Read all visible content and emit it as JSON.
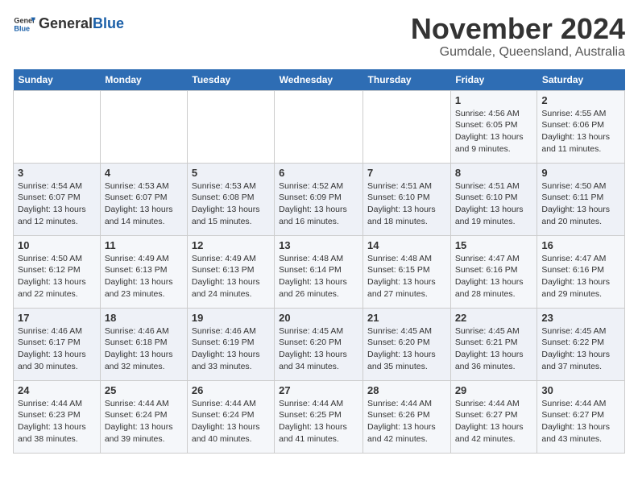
{
  "header": {
    "logo_general": "General",
    "logo_blue": "Blue",
    "month_title": "November 2024",
    "subtitle": "Gumdale, Queensland, Australia"
  },
  "weekdays": [
    "Sunday",
    "Monday",
    "Tuesday",
    "Wednesday",
    "Thursday",
    "Friday",
    "Saturday"
  ],
  "weeks": [
    [
      {
        "day": "",
        "info": ""
      },
      {
        "day": "",
        "info": ""
      },
      {
        "day": "",
        "info": ""
      },
      {
        "day": "",
        "info": ""
      },
      {
        "day": "",
        "info": ""
      },
      {
        "day": "1",
        "info": "Sunrise: 4:56 AM\nSunset: 6:05 PM\nDaylight: 13 hours and 9 minutes."
      },
      {
        "day": "2",
        "info": "Sunrise: 4:55 AM\nSunset: 6:06 PM\nDaylight: 13 hours and 11 minutes."
      }
    ],
    [
      {
        "day": "3",
        "info": "Sunrise: 4:54 AM\nSunset: 6:07 PM\nDaylight: 13 hours and 12 minutes."
      },
      {
        "day": "4",
        "info": "Sunrise: 4:53 AM\nSunset: 6:07 PM\nDaylight: 13 hours and 14 minutes."
      },
      {
        "day": "5",
        "info": "Sunrise: 4:53 AM\nSunset: 6:08 PM\nDaylight: 13 hours and 15 minutes."
      },
      {
        "day": "6",
        "info": "Sunrise: 4:52 AM\nSunset: 6:09 PM\nDaylight: 13 hours and 16 minutes."
      },
      {
        "day": "7",
        "info": "Sunrise: 4:51 AM\nSunset: 6:10 PM\nDaylight: 13 hours and 18 minutes."
      },
      {
        "day": "8",
        "info": "Sunrise: 4:51 AM\nSunset: 6:10 PM\nDaylight: 13 hours and 19 minutes."
      },
      {
        "day": "9",
        "info": "Sunrise: 4:50 AM\nSunset: 6:11 PM\nDaylight: 13 hours and 20 minutes."
      }
    ],
    [
      {
        "day": "10",
        "info": "Sunrise: 4:50 AM\nSunset: 6:12 PM\nDaylight: 13 hours and 22 minutes."
      },
      {
        "day": "11",
        "info": "Sunrise: 4:49 AM\nSunset: 6:13 PM\nDaylight: 13 hours and 23 minutes."
      },
      {
        "day": "12",
        "info": "Sunrise: 4:49 AM\nSunset: 6:13 PM\nDaylight: 13 hours and 24 minutes."
      },
      {
        "day": "13",
        "info": "Sunrise: 4:48 AM\nSunset: 6:14 PM\nDaylight: 13 hours and 26 minutes."
      },
      {
        "day": "14",
        "info": "Sunrise: 4:48 AM\nSunset: 6:15 PM\nDaylight: 13 hours and 27 minutes."
      },
      {
        "day": "15",
        "info": "Sunrise: 4:47 AM\nSunset: 6:16 PM\nDaylight: 13 hours and 28 minutes."
      },
      {
        "day": "16",
        "info": "Sunrise: 4:47 AM\nSunset: 6:16 PM\nDaylight: 13 hours and 29 minutes."
      }
    ],
    [
      {
        "day": "17",
        "info": "Sunrise: 4:46 AM\nSunset: 6:17 PM\nDaylight: 13 hours and 30 minutes."
      },
      {
        "day": "18",
        "info": "Sunrise: 4:46 AM\nSunset: 6:18 PM\nDaylight: 13 hours and 32 minutes."
      },
      {
        "day": "19",
        "info": "Sunrise: 4:46 AM\nSunset: 6:19 PM\nDaylight: 13 hours and 33 minutes."
      },
      {
        "day": "20",
        "info": "Sunrise: 4:45 AM\nSunset: 6:20 PM\nDaylight: 13 hours and 34 minutes."
      },
      {
        "day": "21",
        "info": "Sunrise: 4:45 AM\nSunset: 6:20 PM\nDaylight: 13 hours and 35 minutes."
      },
      {
        "day": "22",
        "info": "Sunrise: 4:45 AM\nSunset: 6:21 PM\nDaylight: 13 hours and 36 minutes."
      },
      {
        "day": "23",
        "info": "Sunrise: 4:45 AM\nSunset: 6:22 PM\nDaylight: 13 hours and 37 minutes."
      }
    ],
    [
      {
        "day": "24",
        "info": "Sunrise: 4:44 AM\nSunset: 6:23 PM\nDaylight: 13 hours and 38 minutes."
      },
      {
        "day": "25",
        "info": "Sunrise: 4:44 AM\nSunset: 6:24 PM\nDaylight: 13 hours and 39 minutes."
      },
      {
        "day": "26",
        "info": "Sunrise: 4:44 AM\nSunset: 6:24 PM\nDaylight: 13 hours and 40 minutes."
      },
      {
        "day": "27",
        "info": "Sunrise: 4:44 AM\nSunset: 6:25 PM\nDaylight: 13 hours and 41 minutes."
      },
      {
        "day": "28",
        "info": "Sunrise: 4:44 AM\nSunset: 6:26 PM\nDaylight: 13 hours and 42 minutes."
      },
      {
        "day": "29",
        "info": "Sunrise: 4:44 AM\nSunset: 6:27 PM\nDaylight: 13 hours and 42 minutes."
      },
      {
        "day": "30",
        "info": "Sunrise: 4:44 AM\nSunset: 6:27 PM\nDaylight: 13 hours and 43 minutes."
      }
    ]
  ]
}
